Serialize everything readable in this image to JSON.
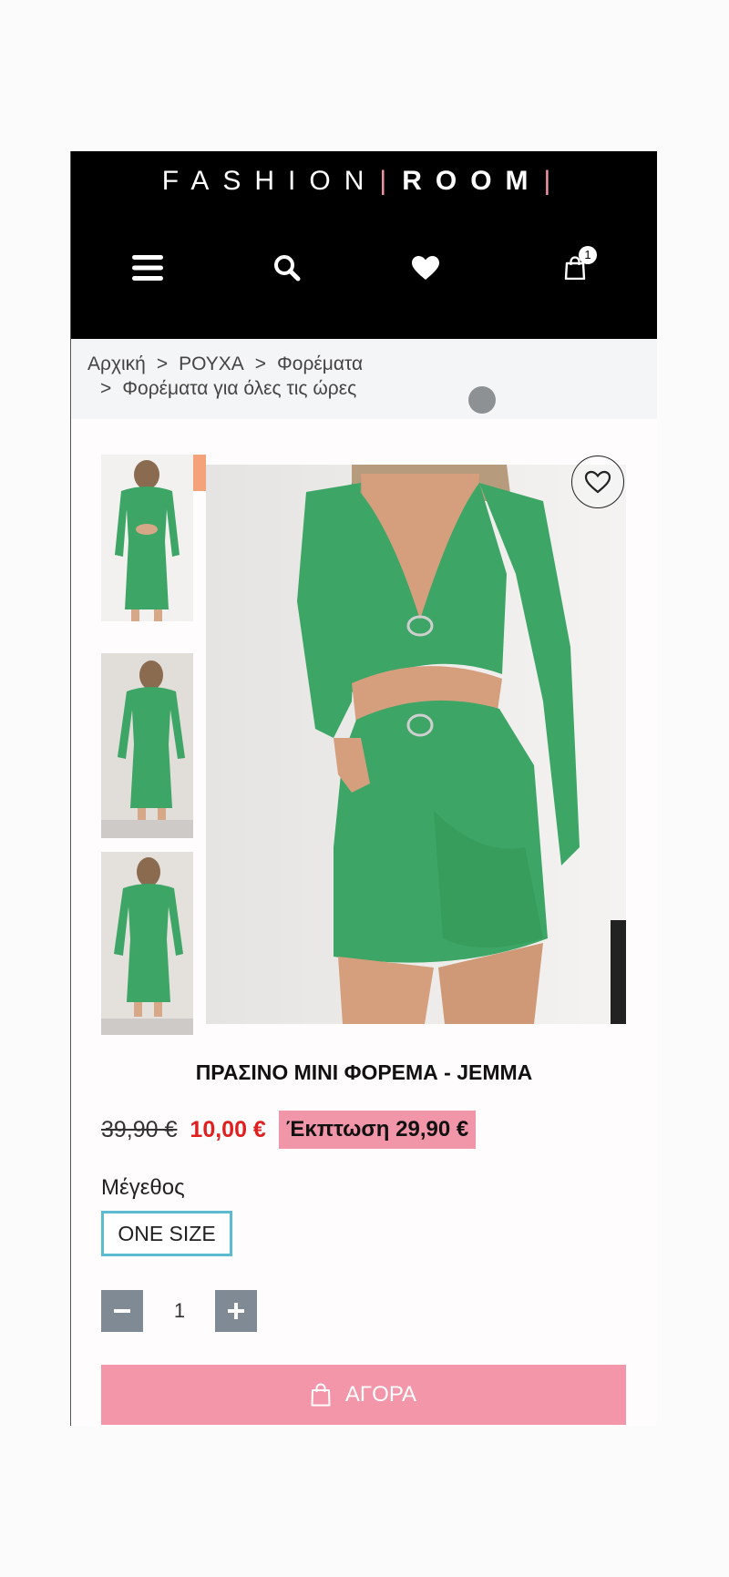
{
  "header": {
    "logo_part1": "FASHION",
    "logo_part2": "ROOM",
    "cart_count": "1"
  },
  "breadcrumb": {
    "items": [
      "Αρχική",
      "ΡΟΥΧΑ",
      "Φορέματα",
      "Φορέματα για όλες τις ώρες"
    ],
    "separator": ">"
  },
  "product": {
    "title": "ΠΡΑΣΙΝΟ ΜΙΝΙ ΦΟΡΕΜΑ - JEMMA",
    "old_price": "39,90 €",
    "new_price": "10,00 €",
    "discount": "Έκπτωση 29,90 €",
    "size_label": "Μέγεθος",
    "size_option": "ONE SIZE",
    "quantity": "1",
    "buy_label": "ΑΓΟΡΑ"
  },
  "colors": {
    "header_bg": "#000000",
    "brand_pink": "#f396a9",
    "dress_green": "#3da565",
    "price_red": "#e0201f",
    "size_border": "#5bbcd0",
    "qty_btn": "#7f8a94"
  },
  "icons": [
    "menu-icon",
    "search-icon",
    "heart-icon",
    "shopping-bag-icon",
    "chevron-right-icon",
    "minus-icon",
    "plus-icon"
  ]
}
